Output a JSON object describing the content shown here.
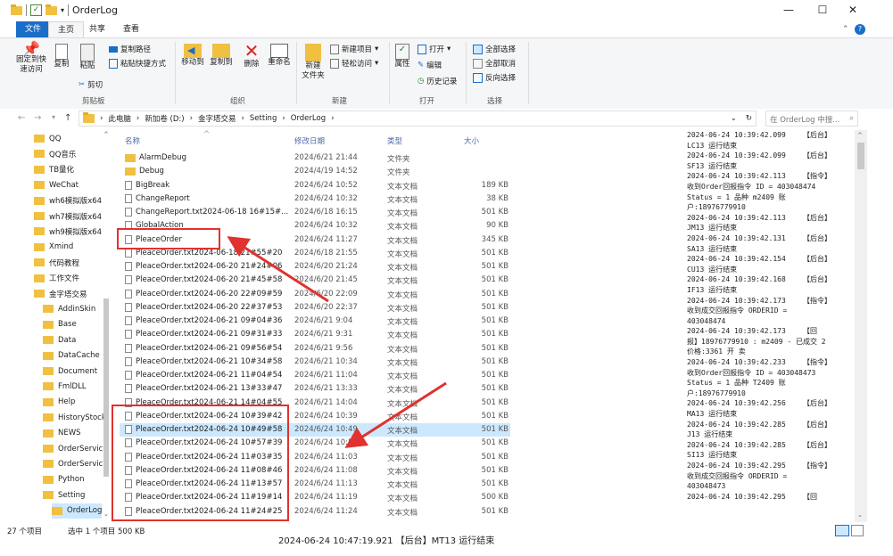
{
  "window": {
    "title": "OrderLog"
  },
  "ribbon_tabs": [
    "文件",
    "主页",
    "共享",
    "查看"
  ],
  "ribbon": {
    "clipboard": {
      "pin": "固定到快速访问",
      "copy": "复制",
      "paste": "粘贴",
      "copy_path": "复制路径",
      "paste_shortcut": "粘贴快捷方式",
      "cut": "剪切",
      "group": "剪贴板"
    },
    "organize": {
      "move_to": "移动到",
      "copy_to": "复制到",
      "delete": "删除",
      "rename": "重命名",
      "group": "组织"
    },
    "new": {
      "new_folder": "新建\n文件夹",
      "new_item": "新建项目",
      "easy_access": "轻松访问",
      "group": "新建"
    },
    "open": {
      "properties": "属性",
      "open": "打开",
      "edit": "编辑",
      "history": "历史记录",
      "group": "打开"
    },
    "select": {
      "select_all": "全部选择",
      "select_none": "全部取消",
      "invert": "反向选择",
      "group": "选择"
    }
  },
  "address": {
    "path": [
      "此电脑",
      "新加卷 (D:)",
      "金字塔交易",
      "Setting",
      "OrderLog"
    ],
    "search_placeholder": "在 OrderLog 中搜..."
  },
  "nav_items": [
    {
      "label": "QQ",
      "indent": 0
    },
    {
      "label": "QQ音乐",
      "indent": 0
    },
    {
      "label": "TB量化",
      "indent": 0
    },
    {
      "label": "WeChat",
      "indent": 0
    },
    {
      "label": "wh6模拟版x64",
      "indent": 0
    },
    {
      "label": "wh7模拟版x64",
      "indent": 0
    },
    {
      "label": "wh9模拟版x64",
      "indent": 0
    },
    {
      "label": "Xmind",
      "indent": 0
    },
    {
      "label": "代码教程",
      "indent": 0
    },
    {
      "label": "工作文件",
      "indent": 0
    },
    {
      "label": "金字塔交易",
      "indent": 0
    },
    {
      "label": "AddinSkin",
      "indent": 1
    },
    {
      "label": "Base",
      "indent": 1
    },
    {
      "label": "Data",
      "indent": 1
    },
    {
      "label": "DataCache",
      "indent": 1
    },
    {
      "label": "Document",
      "indent": 1
    },
    {
      "label": "FmlDLL",
      "indent": 1
    },
    {
      "label": "Help",
      "indent": 1
    },
    {
      "label": "HistoryStock",
      "indent": 1
    },
    {
      "label": "NEWS",
      "indent": 1
    },
    {
      "label": "OrderServic",
      "indent": 1
    },
    {
      "label": "OrderServic",
      "indent": 1
    },
    {
      "label": "Python",
      "indent": 1
    },
    {
      "label": "Setting",
      "indent": 1
    },
    {
      "label": "OrderLog",
      "indent": 2,
      "selected": true
    }
  ],
  "columns": {
    "name": "名称",
    "date": "修改日期",
    "type": "类型",
    "size": "大小"
  },
  "files": [
    {
      "name": "AlarmDebug",
      "date": "2024/6/21 21:44",
      "type": "文件夹",
      "size": "",
      "folder": true
    },
    {
      "name": "Debug",
      "date": "2024/4/19 14:52",
      "type": "文件夹",
      "size": "",
      "folder": true
    },
    {
      "name": "BigBreak",
      "date": "2024/6/24 10:52",
      "type": "文本文档",
      "size": "189 KB"
    },
    {
      "name": "ChangeReport",
      "date": "2024/6/24 10:32",
      "type": "文本文档",
      "size": "38 KB"
    },
    {
      "name": "ChangeReport.txt2024-06-18 16#15#...",
      "date": "2024/6/18 16:15",
      "type": "文本文档",
      "size": "501 KB"
    },
    {
      "name": "GlobalAction",
      "date": "2024/6/24 10:32",
      "type": "文本文档",
      "size": "90 KB"
    },
    {
      "name": "PleaceOrder",
      "date": "2024/6/24 11:27",
      "type": "文本文档",
      "size": "345 KB"
    },
    {
      "name": "PleaceOrder.txt2024-06-18 21#55#20",
      "date": "2024/6/18 21:55",
      "type": "文本文档",
      "size": "501 KB"
    },
    {
      "name": "PleaceOrder.txt2024-06-20 21#24#06",
      "date": "2024/6/20 21:24",
      "type": "文本文档",
      "size": "501 KB"
    },
    {
      "name": "PleaceOrder.txt2024-06-20 21#45#58",
      "date": "2024/6/20 21:45",
      "type": "文本文档",
      "size": "501 KB"
    },
    {
      "name": "PleaceOrder.txt2024-06-20 22#09#59",
      "date": "2024/6/20 22:09",
      "type": "文本文档",
      "size": "501 KB"
    },
    {
      "name": "PleaceOrder.txt2024-06-20 22#37#53",
      "date": "2024/6/20 22:37",
      "type": "文本文档",
      "size": "501 KB"
    },
    {
      "name": "PleaceOrder.txt2024-06-21 09#04#36",
      "date": "2024/6/21 9:04",
      "type": "文本文档",
      "size": "501 KB"
    },
    {
      "name": "PleaceOrder.txt2024-06-21 09#31#33",
      "date": "2024/6/21 9:31",
      "type": "文本文档",
      "size": "501 KB"
    },
    {
      "name": "PleaceOrder.txt2024-06-21 09#56#54",
      "date": "2024/6/21 9:56",
      "type": "文本文档",
      "size": "501 KB"
    },
    {
      "name": "PleaceOrder.txt2024-06-21 10#34#58",
      "date": "2024/6/21 10:34",
      "type": "文本文档",
      "size": "501 KB"
    },
    {
      "name": "PleaceOrder.txt2024-06-21 11#04#54",
      "date": "2024/6/21 11:04",
      "type": "文本文档",
      "size": "501 KB"
    },
    {
      "name": "PleaceOrder.txt2024-06-21 13#33#47",
      "date": "2024/6/21 13:33",
      "type": "文本文档",
      "size": "501 KB"
    },
    {
      "name": "PleaceOrder.txt2024-06-21 14#04#55",
      "date": "2024/6/21 14:04",
      "type": "文本文档",
      "size": "501 KB"
    },
    {
      "name": "PleaceOrder.txt2024-06-24 10#39#42",
      "date": "2024/6/24 10:39",
      "type": "文本文档",
      "size": "501 KB"
    },
    {
      "name": "PleaceOrder.txt2024-06-24 10#49#58",
      "date": "2024/6/24 10:49",
      "type": "文本文档",
      "size": "501 KB",
      "selected": true
    },
    {
      "name": "PleaceOrder.txt2024-06-24 10#57#39",
      "date": "2024/6/24 10:57",
      "type": "文本文档",
      "size": "501 KB"
    },
    {
      "name": "PleaceOrder.txt2024-06-24 11#03#35",
      "date": "2024/6/24 11:03",
      "type": "文本文档",
      "size": "501 KB"
    },
    {
      "name": "PleaceOrder.txt2024-06-24 11#08#46",
      "date": "2024/6/24 11:08",
      "type": "文本文档",
      "size": "501 KB"
    },
    {
      "name": "PleaceOrder.txt2024-06-24 11#13#57",
      "date": "2024/6/24 11:13",
      "type": "文本文档",
      "size": "501 KB"
    },
    {
      "name": "PleaceOrder.txt2024-06-24 11#19#14",
      "date": "2024/6/24 11:19",
      "type": "文本文档",
      "size": "500 KB"
    },
    {
      "name": "PleaceOrder.txt2024-06-24 11#24#25",
      "date": "2024/6/24 11:24",
      "type": "文本文档",
      "size": "501 KB"
    }
  ],
  "log_lines": [
    "2024-06-24 10:39:42.099    【后台】",
    "LC13 运行结束",
    "2024-06-24 10:39:42.099    【后台】",
    "SF13 运行结束",
    "2024-06-24 10:39:42.113    【指令】",
    "收到Order回报指令 ID = 403048474",
    "Status = 1 品种 m2409 账",
    "户:18976779910",
    "2024-06-24 10:39:42.113    【后台】",
    "JM13 运行结束",
    "2024-06-24 10:39:42.131    【后台】",
    "SA13 运行结束",
    "2024-06-24 10:39:42.154    【后台】",
    "CU13 运行结束",
    "2024-06-24 10:39:42.168    【后台】",
    "IF13 运行结束",
    "2024-06-24 10:39:42.173    【指令】",
    "收到成交回报指令 ORDERID =",
    "403048474",
    "2024-06-24 10:39:42.173    【回",
    "报】18976779910 : m2409 - 已成交 2",
    "价格:3361 开 卖",
    "2024-06-24 10:39:42.233    【指令】",
    "收到Order回报指令 ID = 403048473",
    "Status = 1 品种 T2409 账",
    "户:18976779910",
    "2024-06-24 10:39:42.256    【后台】",
    "MA13 运行结束",
    "2024-06-24 10:39:42.285    【后台】",
    "J13 运行结束",
    "2024-06-24 10:39:42.285    【后台】",
    "SI13 运行结束",
    "2024-06-24 10:39:42.295    【指令】",
    "收到成交回报指令 ORDERID =",
    "403048473",
    "2024-06-24 10:39:42.295    【回"
  ],
  "status": {
    "count": "27 个项目",
    "selection": "选中 1 个项目  500 KB"
  },
  "background_text": "2024-06-24 10:47:19.921    【后台】MT13 运行结束",
  "colors": {
    "accent": "#1a6ec8",
    "selection": "#cce8ff",
    "annotation": "#e0322e",
    "folder": "#f0c040"
  }
}
